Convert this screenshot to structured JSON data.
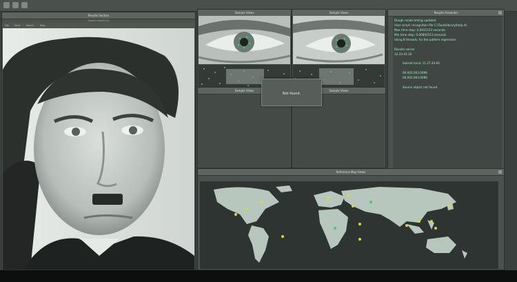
{
  "topbar": {
    "buttons": [
      "window-icon",
      "window-icon",
      "window-icon"
    ]
  },
  "photo_panel": {
    "title": "Results Section",
    "subtitle": "Search results (1)",
    "menu": [
      "File",
      "View",
      "Search",
      "Help"
    ]
  },
  "eye_panels": [
    {
      "title": "Sample Views"
    },
    {
      "title": "Sample Views"
    }
  ],
  "lower_panels": [
    {
      "title": "Sample Views"
    },
    {
      "title": "Sample Views"
    }
  ],
  "dialog": {
    "message": "Not found."
  },
  "results_panel": {
    "title": "Results Presenter",
    "lines": [
      "Dough mode timing updated",
      "User script: recognition file C:\\Tools\\library\\help.rb",
      "Max time step: 0.0031153 seconds",
      "Min time step: 0.00891513 seconds",
      "Using 8 threads, for the pattern regression",
      "",
      "Results server",
      "32.33.43.10",
      "",
      "Subnet local: 11.27.44.82",
      "",
      "00.002.003.0096",
      "00.002.003.0096",
      "",
      "Source object not found"
    ]
  },
  "map_panel": {
    "title": "Reference Map Views"
  },
  "colors": {
    "accent": "#3ecf5a",
    "marker": "#d8d83a",
    "map_land": "#b8c7bd"
  }
}
